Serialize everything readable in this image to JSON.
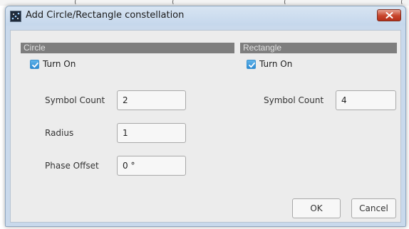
{
  "background": {
    "fragments": [
      "(",
      "(",
      "(",
      "("
    ]
  },
  "window": {
    "title": "Add Circle/Rectangle constellation",
    "icon": "constellation-app-icon",
    "close_icon": "close-icon",
    "colors": {
      "titlebar": "#c9d9ec",
      "close_button": "#c7442b",
      "section_header": "#7e7e7e",
      "checkbox": "#2d8ad2"
    }
  },
  "circle": {
    "header": "Circle",
    "turn_on": {
      "label": "Turn On",
      "checked": true
    },
    "symbol_count": {
      "label": "Symbol Count",
      "value": "2"
    },
    "radius": {
      "label": "Radius",
      "value": "1"
    },
    "phase_offset": {
      "label": "Phase Offset",
      "value": "0 °"
    }
  },
  "rectangle": {
    "header": "Rectangle",
    "turn_on": {
      "label": "Turn On",
      "checked": true
    },
    "symbol_count": {
      "label": "Symbol Count",
      "value": "4"
    }
  },
  "buttons": {
    "ok": "OK",
    "cancel": "Cancel"
  }
}
